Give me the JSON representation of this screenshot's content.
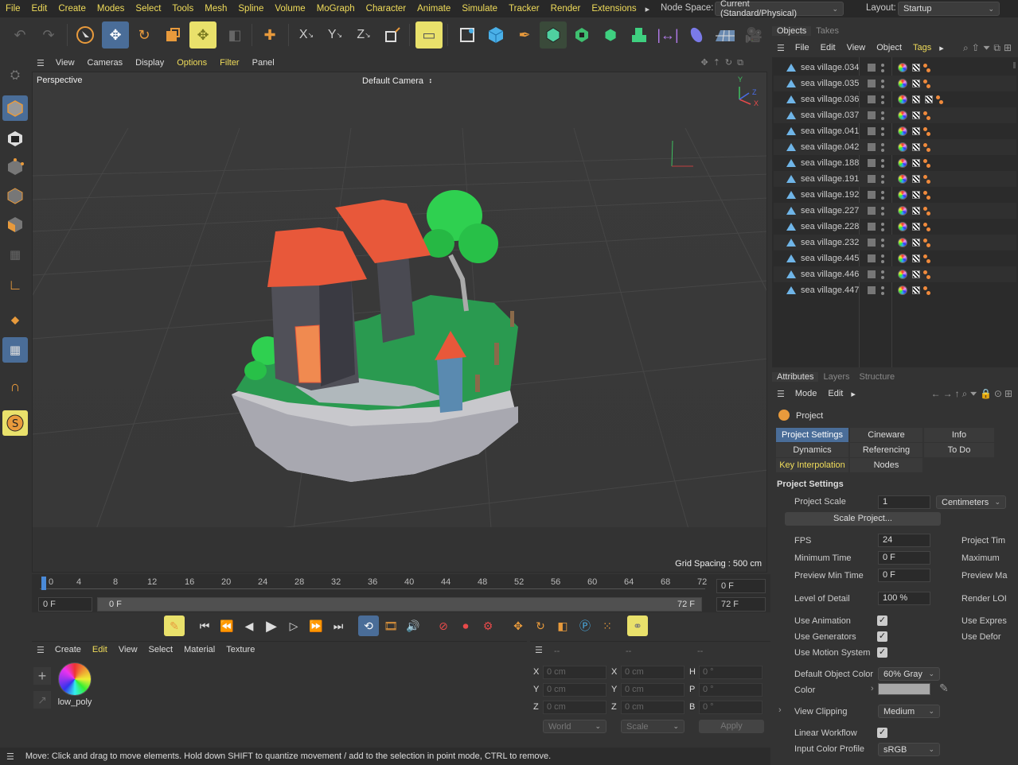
{
  "menubar": {
    "items": [
      "File",
      "Edit",
      "Create",
      "Modes",
      "Select",
      "Tools",
      "Mesh",
      "Spline",
      "Volume",
      "MoGraph",
      "Character",
      "Animate",
      "Simulate",
      "Tracker",
      "Render",
      "Extensions"
    ],
    "more": "▸",
    "node_space_label": "Node Space:",
    "node_space_value": "Current (Standard/Physical)",
    "layout_label": "Layout:",
    "layout_value": "Startup"
  },
  "viewport": {
    "menu": [
      "View",
      "Cameras",
      "Display",
      "Options",
      "Filter",
      "Panel"
    ],
    "active_menu": "Options",
    "view_name": "Perspective",
    "camera": "Default Camera",
    "camera_icon": "⠰",
    "grid_spacing": "Grid Spacing : 500 cm",
    "axis_y": "Y",
    "axis_z": "Z",
    "axis_x": "X"
  },
  "timeline": {
    "ticks": [
      "0",
      "4",
      "8",
      "12",
      "16",
      "20",
      "24",
      "28",
      "32",
      "36",
      "40",
      "44",
      "48",
      "52",
      "56",
      "60",
      "64",
      "68",
      "72"
    ],
    "current_frame": "0 F",
    "start_frame": "0 F",
    "range_start": "0 F",
    "range_end": "72 F",
    "end_frame": "72 F"
  },
  "materials": {
    "menu": [
      "Create",
      "Edit",
      "View",
      "Select",
      "Material",
      "Texture"
    ],
    "active_menu": "Edit",
    "items": [
      {
        "name": "low_poly"
      }
    ]
  },
  "coordinates": {
    "headers": [
      "--",
      "--",
      "--"
    ],
    "rows": [
      {
        "a": "X",
        "av": "0 cm",
        "b": "X",
        "bv": "0 cm",
        "c": "H",
        "cv": "0 °"
      },
      {
        "a": "Y",
        "av": "0 cm",
        "b": "Y",
        "bv": "0 cm",
        "c": "P",
        "cv": "0 °"
      },
      {
        "a": "Z",
        "av": "0 cm",
        "b": "Z",
        "bv": "0 cm",
        "c": "B",
        "cv": "0 °"
      }
    ],
    "mode": "World",
    "transform": "Scale",
    "apply": "Apply"
  },
  "status": "Move: Click and drag to move elements. Hold down SHIFT to quantize movement / add to the selection in point mode, CTRL to remove.",
  "objects": {
    "tabs": [
      "Objects",
      "Takes"
    ],
    "menu": [
      "File",
      "Edit",
      "View",
      "Object",
      "Tags"
    ],
    "active_menu": "Tags",
    "more": "▸",
    "rows": [
      {
        "name": "sea village.034",
        "tags": 2
      },
      {
        "name": "sea village.035",
        "tags": 2
      },
      {
        "name": "sea village.036",
        "tags": 3
      },
      {
        "name": "sea village.037",
        "tags": 2
      },
      {
        "name": "sea village.041",
        "tags": 2
      },
      {
        "name": "sea village.042",
        "tags": 2
      },
      {
        "name": "sea village.188",
        "tags": 2
      },
      {
        "name": "sea village.191",
        "tags": 2
      },
      {
        "name": "sea village.192",
        "tags": 2
      },
      {
        "name": "sea village.227",
        "tags": 2
      },
      {
        "name": "sea village.228",
        "tags": 2
      },
      {
        "name": "sea village.232",
        "tags": 2
      },
      {
        "name": "sea village.445",
        "tags": 2
      },
      {
        "name": "sea village.446",
        "tags": 2
      },
      {
        "name": "sea village.447",
        "tags": 2
      }
    ]
  },
  "attributes": {
    "tabs": [
      "Attributes",
      "Layers",
      "Structure"
    ],
    "menu": [
      "Mode",
      "Edit"
    ],
    "more": "▸",
    "object": "Project",
    "subtabs": [
      {
        "label": "Project Settings",
        "active": true
      },
      {
        "label": "Cineware"
      },
      {
        "label": "Info"
      },
      {
        "label": "Dynamics"
      },
      {
        "label": "Referencing"
      },
      {
        "label": "To Do"
      },
      {
        "label": "Key Interpolation",
        "yellow": true
      },
      {
        "label": "Nodes"
      }
    ],
    "section": "Project Settings",
    "project_scale_label": "Project Scale",
    "project_scale": "1",
    "scale_unit": "Centimeters",
    "scale_project": "Scale Project...",
    "fps_label": "FPS",
    "fps": "24",
    "project_time_label": "Project Tim",
    "min_time_label": "Minimum Time",
    "min_time": "0 F",
    "max_label": "Maximum",
    "preview_min_label": "Preview Min Time",
    "preview_min": "0 F",
    "preview_max_label": "Preview Ma",
    "lod_label": "Level of Detail",
    "lod": "100 %",
    "render_lod_label": "Render LOI",
    "use_animation": "Use Animation",
    "use_expressions": "Use Expres",
    "use_generators": "Use Generators",
    "use_deformers": "Use Defor",
    "use_motion_system": "Use Motion System",
    "default_color_label": "Default Object Color",
    "default_color": "60% Gray",
    "color_label": "Color",
    "color_swatch": "#a8a8a8",
    "view_clipping_label": "View Clipping",
    "view_clipping": "Medium",
    "linear_workflow": "Linear Workflow",
    "input_profile_label": "Input Color Profile",
    "input_profile": "sRGB"
  },
  "colors": {
    "accent_yellow": "#f0dc5a",
    "active_blue": "#4a6d98",
    "background": "#333333"
  }
}
